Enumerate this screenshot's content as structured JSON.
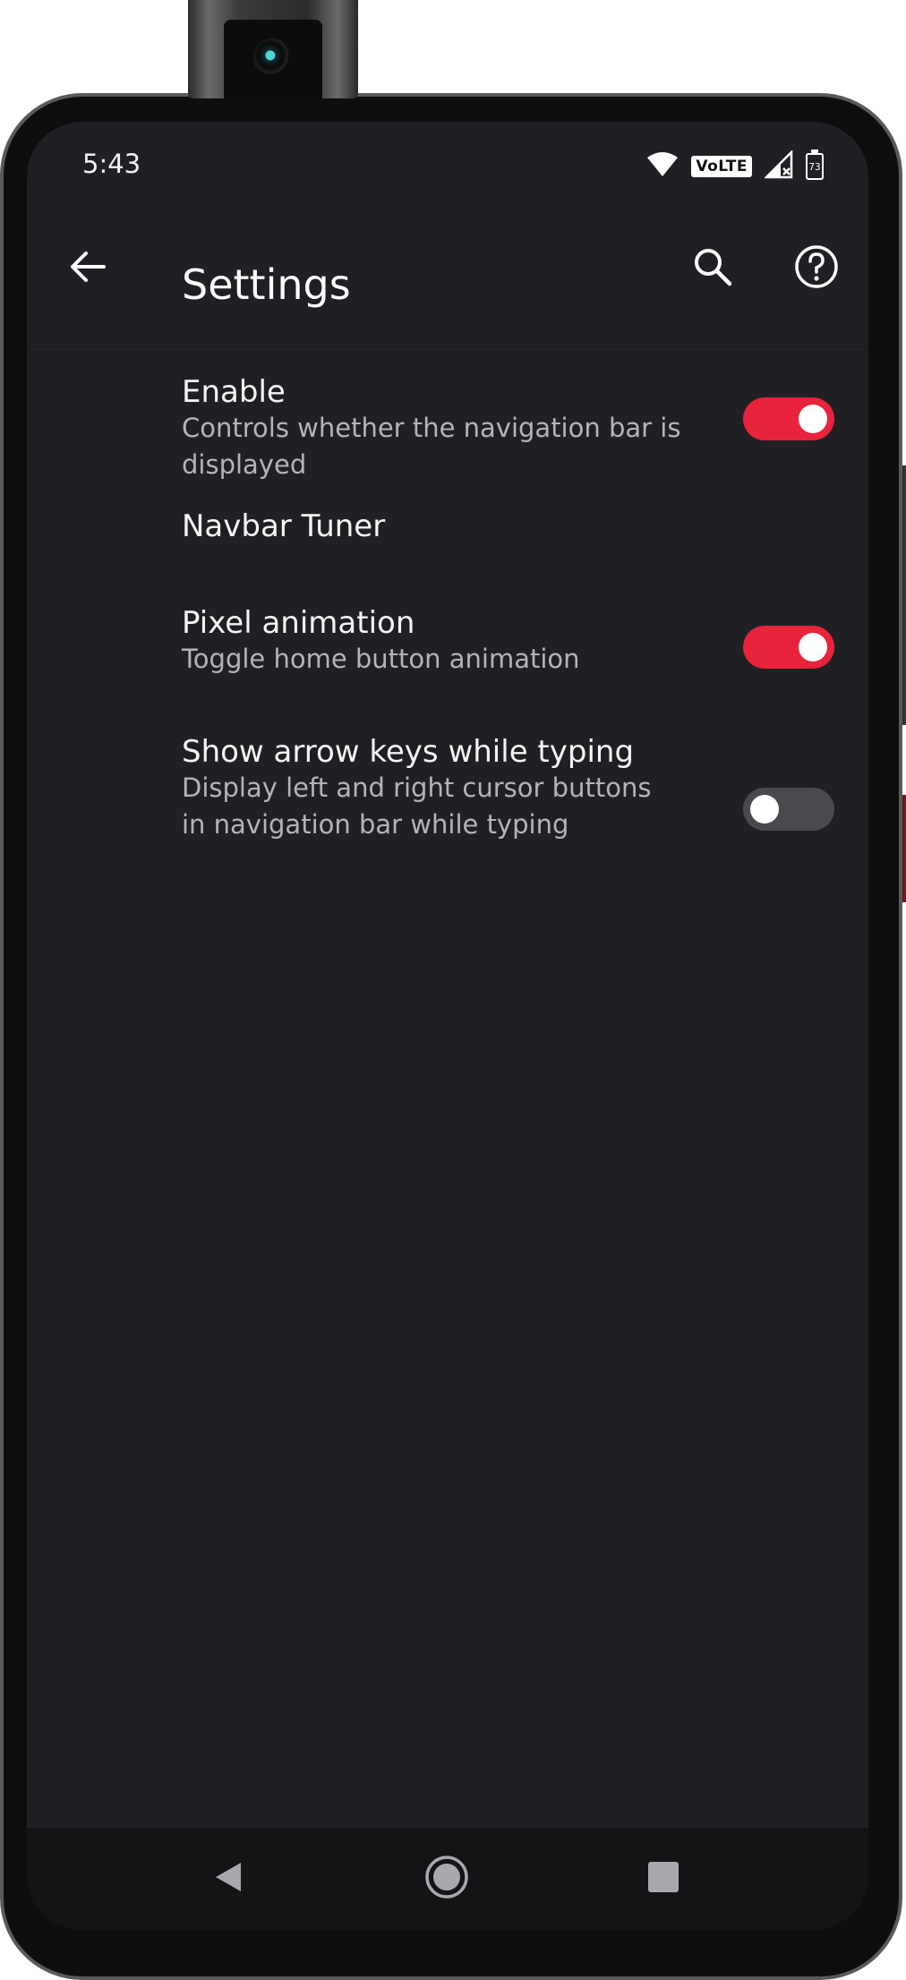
{
  "status_bar": {
    "time": "5:43",
    "network_badge": "VoLTE",
    "battery_level": "73",
    "icons": [
      "wifi-icon",
      "volte-icon",
      "signal-icon",
      "battery-icon"
    ]
  },
  "toolbar": {
    "title": "Settings",
    "icons": [
      "back-arrow-icon",
      "search-icon",
      "help-icon"
    ]
  },
  "preferences": [
    {
      "title": "Enable",
      "summary": "Controls whether the navigation bar is displayed",
      "switch_on": true
    },
    {
      "title": "Navbar Tuner",
      "summary": ""
    },
    {
      "title": "Pixel animation",
      "summary": "Toggle home button animation",
      "switch_on": true
    },
    {
      "title": "Show arrow keys while typing",
      "summary": "Display left and right cursor buttons in navigation bar while typing",
      "switch_on": false
    }
  ],
  "nav_bar": {
    "icons": [
      "back-triangle-icon",
      "home-circle-icon",
      "recents-square-icon"
    ]
  },
  "colors": {
    "background": "#202024",
    "accent": "#e8233c",
    "switch_off_track": "#4a4a4e",
    "text_primary": "#f4f4f4",
    "text_secondary": "#b4b4b8",
    "nav_bar": "#141416"
  }
}
